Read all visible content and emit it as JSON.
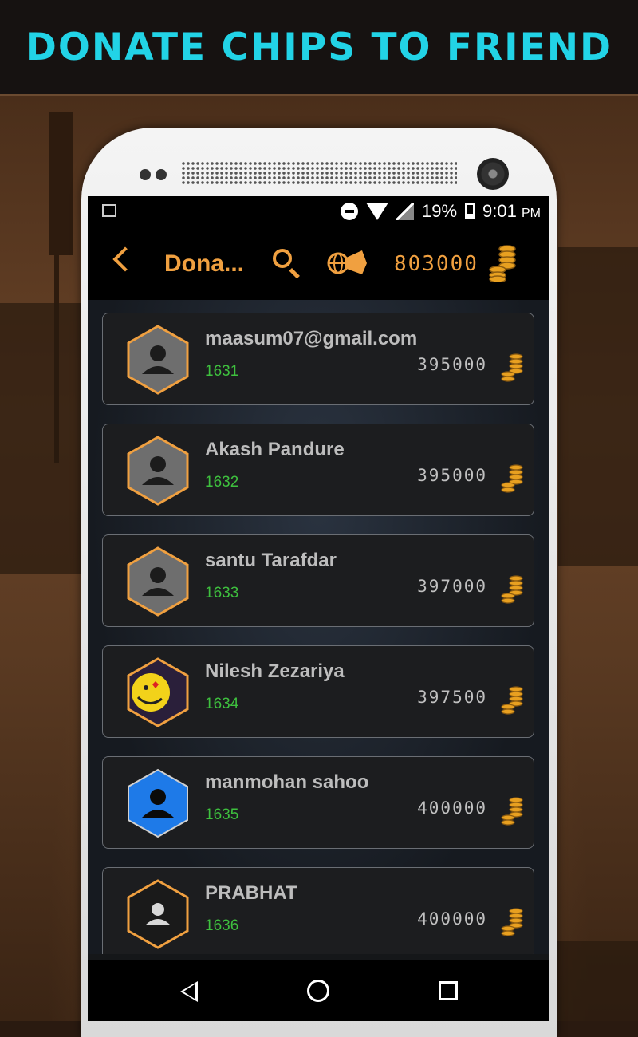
{
  "banner": {
    "title": "DONATE CHIPS TO FRIEND"
  },
  "status_bar": {
    "battery": "19%",
    "time": "9:01",
    "ampm": "PM"
  },
  "toolbar": {
    "title": "Dona...",
    "balance": "803000"
  },
  "friends": [
    {
      "name": "maasum07@gmail.com",
      "id": "1631",
      "chips": "395000",
      "avatar": "default-gray"
    },
    {
      "name": "Akash Pandure",
      "id": "1632",
      "chips": "395000",
      "avatar": "default-gray"
    },
    {
      "name": "santu Tarafdar",
      "id": "1633",
      "chips": "397000",
      "avatar": "default-gray"
    },
    {
      "name": "Nilesh Zezariya",
      "id": "1634",
      "chips": "397500",
      "avatar": "smiley-photo"
    },
    {
      "name": "manmohan sahoo",
      "id": "1635",
      "chips": "400000",
      "avatar": "default-blue"
    },
    {
      "name": "PRABHAT",
      "id": "1636",
      "chips": "400000",
      "avatar": "default-dark"
    }
  ],
  "colors": {
    "accent": "#f0a040",
    "banner_text": "#22d3e6",
    "id_green": "#3ec03e"
  },
  "icons": [
    "back-icon",
    "search-icon",
    "horn-globe-icon",
    "coins-icon",
    "nav-back-icon",
    "nav-home-icon",
    "nav-recent-icon"
  ]
}
